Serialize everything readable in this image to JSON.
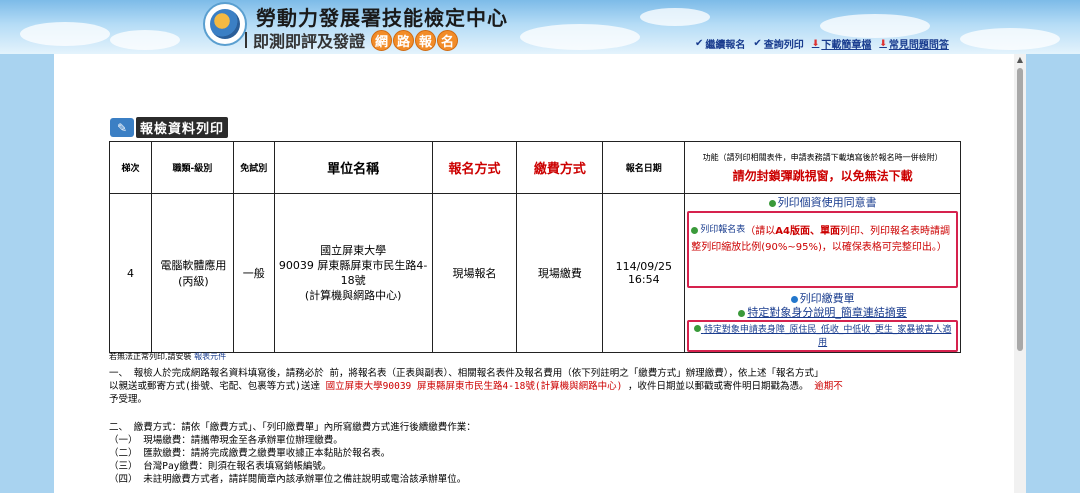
{
  "header": {
    "title": "勞動力發展署技能檢定中心",
    "subtitle": "即測即評及發證",
    "bubble_chars": [
      "網",
      "路",
      "報",
      "名"
    ],
    "nav": [
      {
        "label": "繼續報名",
        "icon": "check-icon"
      },
      {
        "label": "查詢列印",
        "icon": "check-icon"
      },
      {
        "label": "下載簡章檔",
        "icon": "download-icon"
      },
      {
        "label": "常見問題問答",
        "icon": "download-icon"
      }
    ]
  },
  "section": {
    "title": "報檢資料列印"
  },
  "table": {
    "headers": {
      "seq": "梯次",
      "category": "職類-級別",
      "exam_type": "免試別",
      "unit": "單位名稱",
      "reg_method": "報名方式",
      "pay_method": "繳費方式",
      "reg_date": "報名日期",
      "func_note": "功能（請列印相關表件，申請表務請下載填寫後於報名時一併檢附）",
      "func_warn": "請勿封鎖彈跳視窗，以免無法下載"
    },
    "row": {
      "seq": "4",
      "category": "電腦軟體應用(丙級)",
      "exam_type": "一般",
      "unit_name": "國立屏東大學",
      "unit_address": "90039 屏東縣屏東市民生路4-18號",
      "unit_place": "(計算機與網路中心)",
      "reg_method": "現場報名",
      "pay_method": "現場繳費",
      "reg_date": "114/09/25 16:54"
    },
    "functions": {
      "consent": "列印個資使用同意書",
      "print_form": "列印報名表",
      "print_form_note_1": "（請以",
      "print_form_note_bold": "A4版面、單面",
      "print_form_note_2": "列印、列印報名表時請調整列印縮放比例(90%~95%)，以確保表格可完整印出。）",
      "print_payment": "列印繳費單",
      "special_explain": "特定對象身分說明_簡章連結摘要",
      "special_form": "特定對象申請表身障_原住民_低收_中低收_更生_家暴被害人適用"
    }
  },
  "notes": {
    "small_prefix": "若無法正常列印,請安裝",
    "small_link": "報表元件",
    "p1_a": "一、 報檢人於完成網路報名資料填寫後，請務必於 前，將報名表（正表與副表）、相關報名表件及報名費用（依下列註明之「繳費方式」辦理繳費），依上述「報名方式」",
    "p1_b": "以親送或郵寄方式(掛號、宅配、包裹等方式)送達 ",
    "p1_red": "國立屏東大學90039 屏東縣屏東市民生路4-18號(計算機與網路中心)",
    "p1_c": " ，收件日期並以郵戳或寄件明日期戳為憑。 ",
    "p1_red2": "逾期不",
    "p1_d": "予受理。",
    "p2_a": "二、 繳費方式：請依「繳費方式」、「列印繳費單」內所寫繳費方式進行後續繳費作業：",
    "p2_b": "（一） 現場繳費：請攜帶現金至各承辦單位辦理繳費。",
    "p2_c": "（二） 匯款繳費：請將完成繳費之繳費單收據正本黏貼於報名表。",
    "p2_d": "（三） 台灣Pay繳費：則須在報名表填寫銷帳編號。",
    "p2_e": "（四） 未註明繳費方式者，請詳閱簡章內該承辦單位之備註說明或電洽該承辦單位。"
  }
}
